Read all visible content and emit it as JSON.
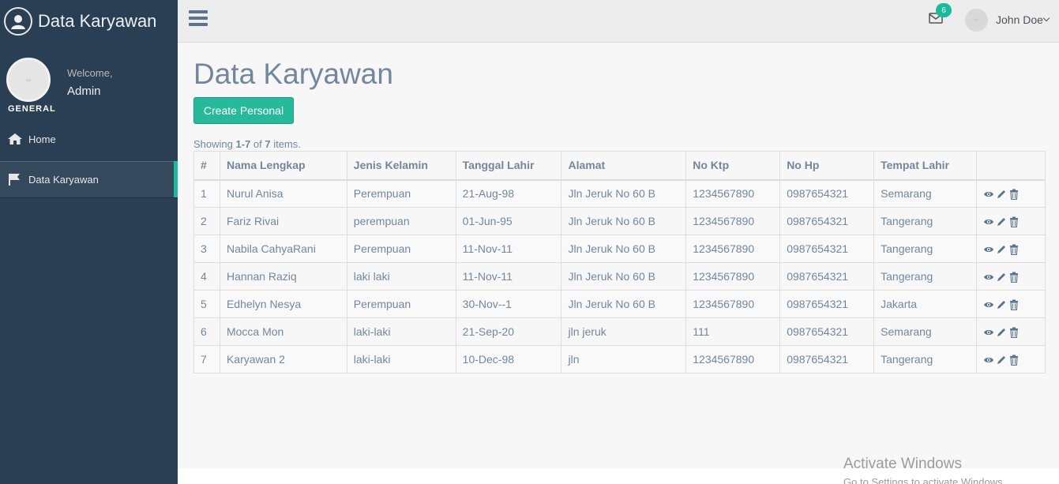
{
  "brand": {
    "title": "Data Karyawan",
    "icon": "paw-icon"
  },
  "profile": {
    "welcome": "Welcome,",
    "name": "Admin",
    "section": "GENERAL"
  },
  "sidebar": {
    "items": [
      {
        "label": "Home",
        "icon": "home-icon"
      },
      {
        "label": "Data Karyawan",
        "icon": "flag-icon"
      }
    ]
  },
  "topnav": {
    "badge_count": "6",
    "user_name": "John Doe"
  },
  "main": {
    "title": "Data Karyawan",
    "create_label": "Create Personal",
    "summary": {
      "prefix": "Showing ",
      "range": "1-7",
      "of": " of ",
      "total": "7",
      "suffix": " items."
    }
  },
  "table": {
    "headers": [
      "#",
      "Nama Lengkap",
      "Jenis Kelamin",
      "Tanggal Lahir",
      "Alamat",
      "No Ktp",
      "No Hp",
      "Tempat Lahir",
      ""
    ],
    "rows": [
      [
        "1",
        "Nurul Anisa",
        "Perempuan",
        "21-Aug-98",
        "Jln Jeruk No 60 B",
        "1234567890",
        "0987654321",
        "Semarang"
      ],
      [
        "2",
        "Fariz Rivai",
        "perempuan",
        "01-Jun-95",
        "Jln Jeruk No 60 B",
        "1234567890",
        "0987654321",
        "Tangerang"
      ],
      [
        "3",
        "Nabila CahyaRani",
        "Perempuan",
        "11-Nov-11",
        "Jln Jeruk No 60 B",
        "1234567890",
        "0987654321",
        "Tangerang"
      ],
      [
        "4",
        "Hannan Raziq",
        "laki laki",
        "11-Nov-11",
        "Jln Jeruk No 60 B",
        "1234567890",
        "0987654321",
        "Tangerang"
      ],
      [
        "5",
        "Edhelyn Nesya",
        "Perempuan",
        "30-Nov--1",
        "Jln Jeruk No 60 B",
        "1234567890",
        "0987654321",
        "Jakarta"
      ],
      [
        "6",
        "Mocca Mon",
        "laki-laki",
        "21-Sep-20",
        "jln jeruk",
        "111",
        "0987654321",
        "Semarang"
      ],
      [
        "7",
        "Karyawan 2",
        "laki-laki",
        "10-Dec-98",
        "jln",
        "1234567890",
        "0987654321",
        "Tangerang"
      ]
    ]
  },
  "watermark": {
    "line1": "Activate Windows",
    "line2": "Go to Settings to activate Windows."
  },
  "colors": {
    "sidebar": "#2A3F54",
    "accent": "#1ABB9C",
    "button": "#26B99A",
    "text": "#73879C"
  }
}
